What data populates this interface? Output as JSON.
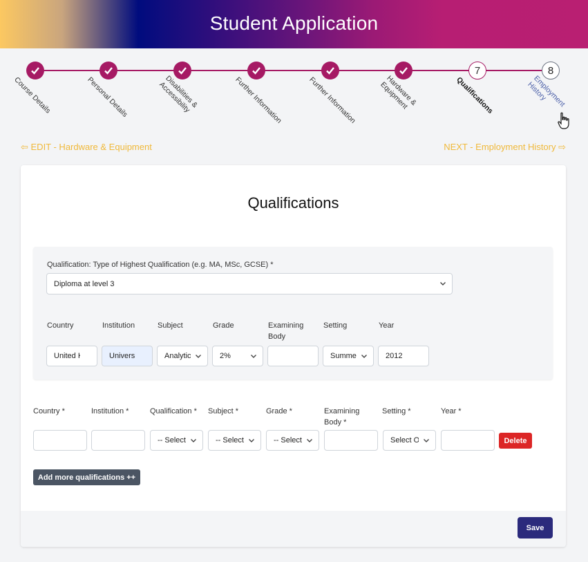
{
  "header": {
    "title": "Student Application"
  },
  "stepper": {
    "steps": [
      {
        "label": "Course Details",
        "state": "done"
      },
      {
        "label": "Personal Details",
        "state": "done"
      },
      {
        "label": "Disabilities & Accessibility",
        "state": "done"
      },
      {
        "label": "Further Information",
        "state": "done"
      },
      {
        "label": "Further Information",
        "state": "done"
      },
      {
        "label": "Hardware & Equipment",
        "state": "done"
      },
      {
        "label": "Qualifications",
        "number": "7",
        "state": "current"
      },
      {
        "label": "Employment History",
        "number": "8",
        "state": "todo"
      }
    ],
    "labels": {
      "l1": "Course Details",
      "l2": "Personal Details",
      "l3a": "Disabilities &",
      "l3b": "Accessibility",
      "l4": "Further Information",
      "l5": "Further Information",
      "l6a": "Hardware &",
      "l6b": "Equipment",
      "l7": "Qualifications",
      "l8a": "Employment",
      "l8b": "History",
      "n7": "7",
      "n8": "8"
    }
  },
  "nav": {
    "prev": "⇦ EDIT - Hardware & Equipment",
    "next": "NEXT - Employment History ⇨"
  },
  "form": {
    "title": "Qualifications",
    "highest": {
      "label": "Qualification: Type of Highest Qualification (e.g. MA, MSc, GCSE) *",
      "value": "Diploma at level 3"
    },
    "saved_row": {
      "headers": {
        "country": "Country",
        "institution": "Institution",
        "subject": "Subject",
        "grade": "Grade",
        "examining_body_a": "Examining",
        "examining_body_b": "Body",
        "setting": "Setting",
        "year": "Year"
      },
      "values": {
        "country": "United Kingdom",
        "institution": "University",
        "subject": "Analytics",
        "grade": "2%",
        "examining_body": "",
        "setting": "Summer",
        "year": "2012"
      }
    },
    "new_row": {
      "headers": {
        "country": "Country *",
        "institution": "Institution *",
        "qualification": "Qualification *",
        "subject": "Subject *",
        "grade": "Grade *",
        "examining_body_a": "Examining",
        "examining_body_b": "Body *",
        "setting": "Setting *",
        "year": "Year *"
      },
      "values": {
        "country": "",
        "institution": "",
        "qualification": "-- Select --",
        "subject": "-- Select --",
        "grade": "-- Select --",
        "examining_body": "",
        "setting": "Select Option",
        "year": ""
      },
      "delete_label": "Delete"
    },
    "add_more_label": "Add more qualifications ++",
    "save_label": "Save"
  },
  "colors": {
    "accent": "#a61a64",
    "nav_link": "#f0b93a",
    "save": "#2b2a7c",
    "delete": "#dc2626",
    "add": "#4b5563"
  }
}
